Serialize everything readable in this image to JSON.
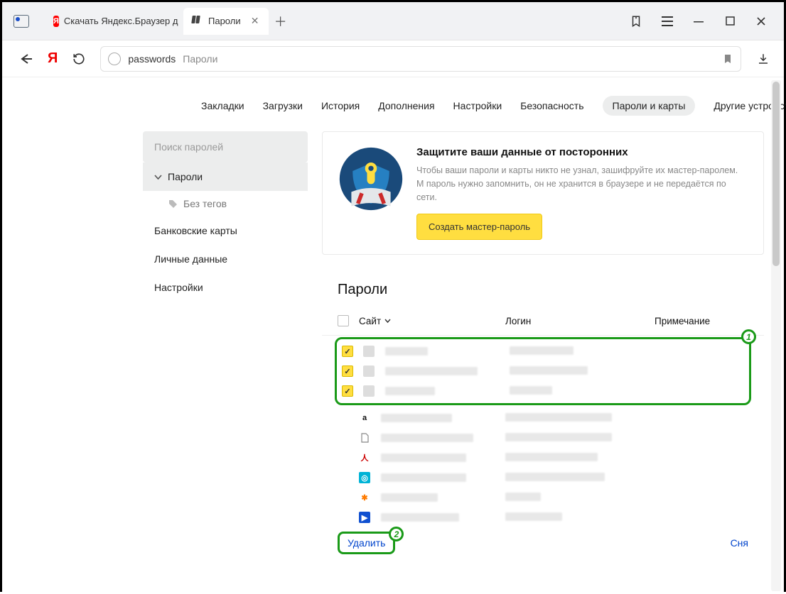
{
  "tabs": {
    "inactive": "Скачать Яндекс.Браузер д",
    "active": "Пароли"
  },
  "address": {
    "path": "passwords",
    "title": "Пароли"
  },
  "topmenu": {
    "bookmarks": "Закладки",
    "downloads": "Загрузки",
    "history": "История",
    "addons": "Дополнения",
    "settings": "Настройки",
    "security": "Безопасность",
    "passwords": "Пароли и карты",
    "devices": "Другие устройства"
  },
  "sidebar": {
    "search_placeholder": "Поиск паролей",
    "passwords": "Пароли",
    "untagged": "Без тегов",
    "bankcards": "Банковские карты",
    "personal": "Личные данные",
    "settings": "Настройки"
  },
  "card": {
    "title": "Защитите ваши данные от посторонних",
    "text": "Чтобы ваши пароли и карты никто не узнал, зашифруйте их мастер-паролем. М пароль нужно запомнить, он не хранится в браузере и не передаётся по сети.",
    "button": "Создать мастер-пароль"
  },
  "list": {
    "header": "Пароли",
    "col_site": "Сайт",
    "col_login": "Логин",
    "col_note": "Примечание"
  },
  "footer": {
    "delete": "Удалить",
    "deselect": "Сня"
  },
  "annot": {
    "one": "1",
    "two": "2"
  }
}
